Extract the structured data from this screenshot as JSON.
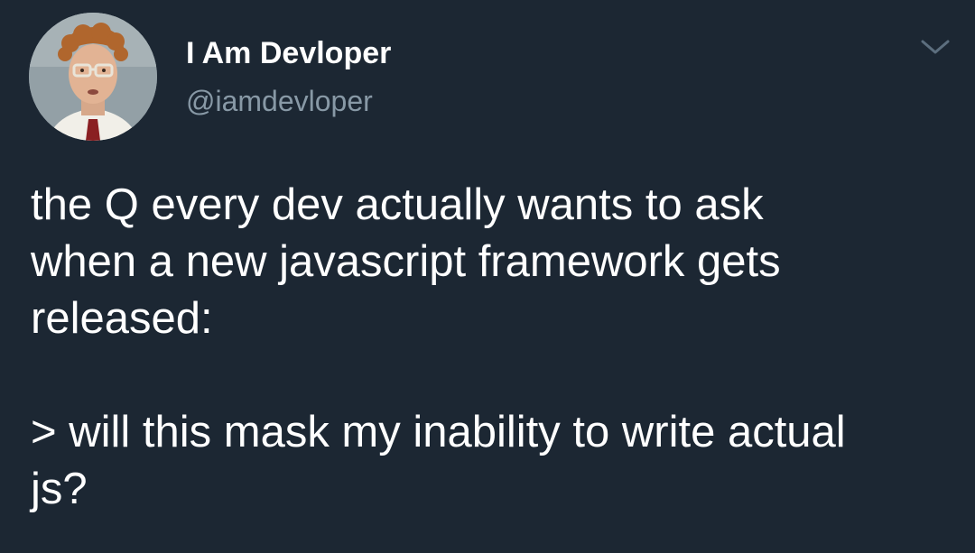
{
  "author": {
    "display_name": "I Am Devloper",
    "handle": "@iamdevloper",
    "avatar_icon": "profile-photo"
  },
  "tweet": {
    "text": "the Q every dev actually wants to ask\nwhen a new javascript framework gets\nreleased:\n\n> will this mask my inability to write actual\njs?"
  },
  "menu": {
    "icon": "chevron-down-icon"
  },
  "colors": {
    "background": "#1c2733",
    "text": "#ffffff",
    "secondary_text": "#8899a6",
    "chevron": "#5c6e7e"
  }
}
